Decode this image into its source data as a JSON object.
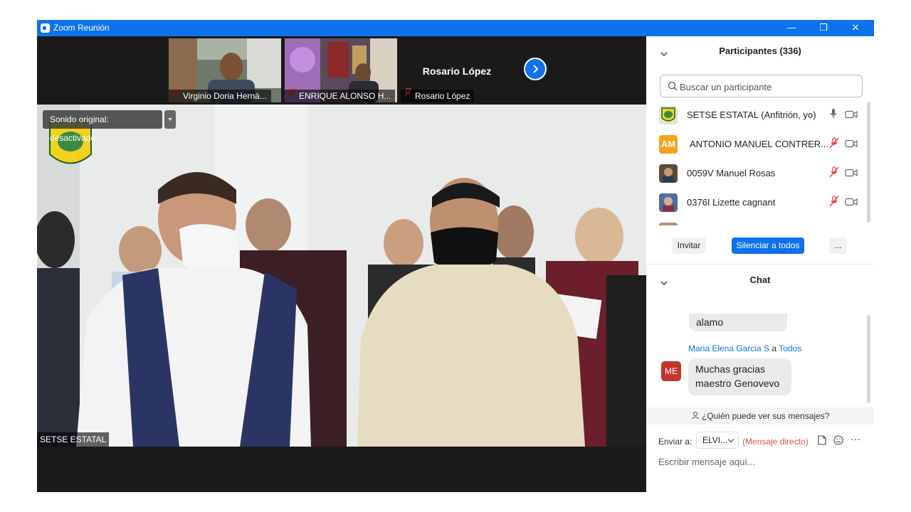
{
  "window": {
    "title": "Zoom Reunión",
    "controls": {
      "minimize": "—",
      "restore": "❐",
      "close": "✕"
    }
  },
  "gallery": {
    "thumbnails": [
      {
        "name": "Virginio Doria Herná..."
      },
      {
        "name": "ENRIQUE ALONSO H..."
      },
      {
        "name": "Rosario López",
        "display_name": "Rosario López"
      }
    ]
  },
  "main_video": {
    "sound_label": "Sonido original: desactivado",
    "speaker_name": "SETSE ESTATAL"
  },
  "participants": {
    "header": "Participantes (336)",
    "search_placeholder": "Buscar un participante",
    "list": [
      {
        "name": "SETSE ESTATAL (Anfitrión, yo)",
        "avatar": "logo",
        "mic": "on"
      },
      {
        "name": "ANTONIO MANUEL CONTRER...",
        "avatar": "AM",
        "avatar_color": "#f5a31a",
        "mic": "muted"
      },
      {
        "name": "0059V Manuel Rosas",
        "avatar": "photo",
        "mic": "muted"
      },
      {
        "name": "0376I Lizette cagnant",
        "avatar": "photo",
        "mic": "muted"
      }
    ],
    "invite_label": "Invitar",
    "mute_all_label": "Silenciar a todos",
    "more_label": "..."
  },
  "chat": {
    "header": "Chat",
    "messages": [
      {
        "text": "alamo"
      },
      {
        "sender": "Maria Elena Garcia S",
        "to_label": "a",
        "recipient": "Todos",
        "avatar": "ME",
        "lines": [
          "Muchas gracias",
          "maestro Genovevo"
        ]
      }
    ],
    "who_can_see": "¿Quién puede ver sus mensajes?",
    "send_to_label": "Enviar a:",
    "send_to_value": "ELVI...",
    "direct_label": "(Mensaje directo)",
    "input_placeholder": "Escribir mensaje aquí...",
    "more_label": "···"
  },
  "colors": {
    "accent": "#0e72ed",
    "muted_red": "#e0443d",
    "title_bar": "#0e72ed"
  }
}
